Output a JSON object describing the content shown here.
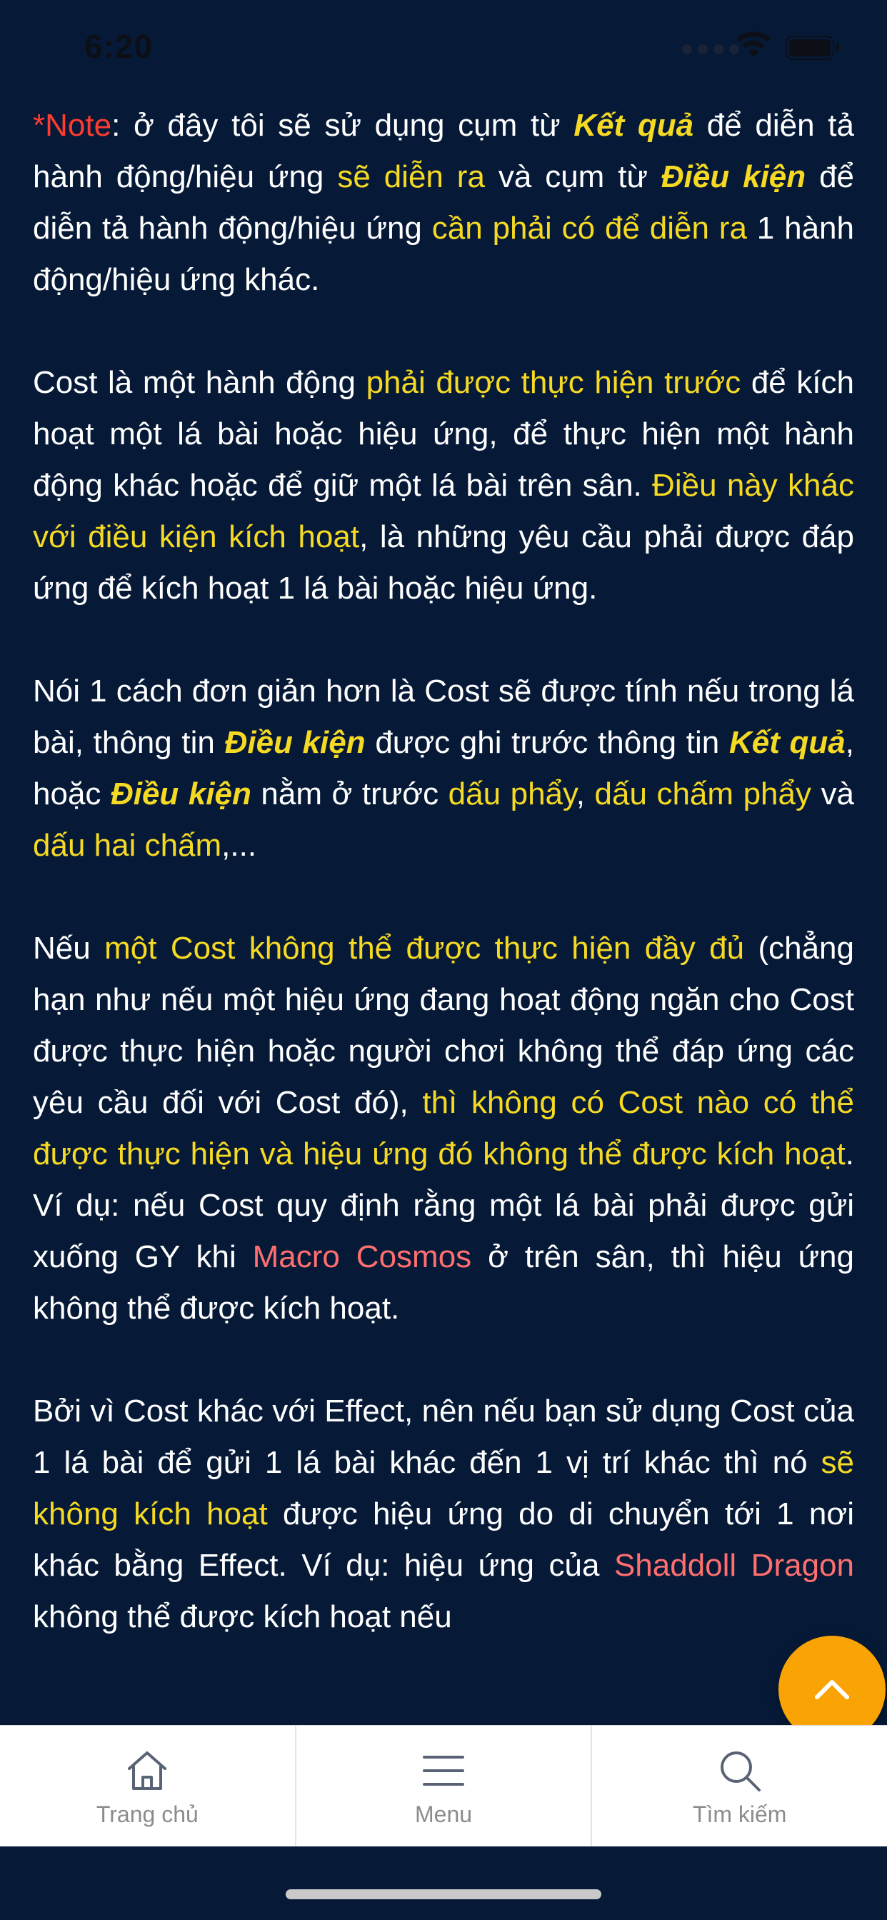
{
  "status": {
    "time": "6:20"
  },
  "paragraphs": {
    "p1": {
      "note": "*Note",
      "t1": ": ở đây tôi sẽ sử dụng cụm từ ",
      "ketqua": "Kết quả",
      "t2": " để diễn tả hành động/hiệu ứng ",
      "hl1": "sẽ diễn ra",
      "t3": " và cụm từ ",
      "dieukien": "Điều kiện",
      "t4": " để diễn tả hành động/hiệu ứng ",
      "hl2": "cần phải có để diễn ra",
      "t5": " 1 hành động/hiệu ứng khác."
    },
    "p2": {
      "t1": "Cost là một hành động ",
      "hl1": "phải được thực hiện trước",
      "t2": " để kích hoạt một lá bài hoặc hiệu ứng, để thực hiện một hành động khác hoặc để giữ một lá bài trên sân. ",
      "hl2": "Điều này khác với điều kiện kích hoạt",
      "t3": ", là những yêu cầu phải được đáp ứng để kích hoạt 1 lá bài hoặc hiệu ứng."
    },
    "p3": {
      "t1": "Nói 1 cách đơn giản hơn là Cost sẽ được tính nếu trong lá bài, thông tin ",
      "dieukien1": "Điều kiện",
      "t2": " được ghi trước thông tin ",
      "ketqua": "Kết quả",
      "t3": ", hoặc ",
      "dieukien2": "Điều kiện",
      "t4": " nằm ở trước ",
      "hl1": "dấu phẩy",
      "t5": ", ",
      "hl2": "dấu chấm phẩy",
      "t6": " và ",
      "hl3": "dấu hai chấm",
      "t7": ",..."
    },
    "p4": {
      "t1": "Nếu ",
      "hl1": "một Cost không thể được thực hiện đầy đủ",
      "t2": " (chẳng hạn như nếu một hiệu ứng đang hoạt động ngăn cho Cost được thực hiện hoặc người chơi không thể đáp ứng các yêu cầu đối với Cost đó), ",
      "hl2": "thì không có Cost nào có thể được thực hiện và hiệu ứng đó không thể được kích hoạt",
      "t3": ". Ví dụ: nếu Cost quy định rằng một lá bài phải được gửi xuống GY khi ",
      "card": "Macro Cosmos",
      "t4": " ở trên sân, thì hiệu ứng không thể được kích hoạt."
    },
    "p5": {
      "t1": "Bởi vì Cost khác với Effect, nên nếu bạn sử dụng Cost của 1 lá bài để gửi 1 lá bài khác đến 1 vị trí khác thì nó ",
      "hl1": "sẽ không kích hoạt",
      "t2": " được hiệu ứng do di chuyển tới 1 nơi khác bằng Effect. Ví dụ: hiệu ứng của ",
      "card": "Shaddoll Dragon",
      "t3": " không thể được kích hoạt nếu"
    }
  },
  "fab": {
    "icon": "chevron-up-icon"
  },
  "tabbar": {
    "home": "Trang chủ",
    "menu": "Menu",
    "search": "Tìm kiếm"
  },
  "colors": {
    "background": "#061a38",
    "highlight": "#f5d923",
    "note": "#ff3b30",
    "card_name": "#ff6f6f",
    "fab": "#f9a304"
  }
}
